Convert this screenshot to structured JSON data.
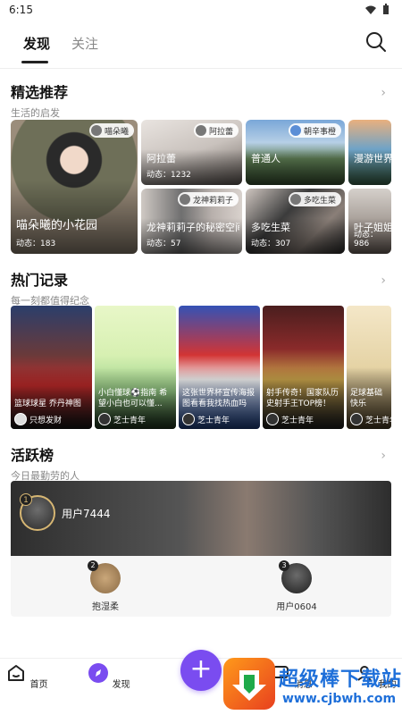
{
  "status": {
    "time": "6:15"
  },
  "nav": {
    "tab_active": "发现",
    "tab_inactive": "关注"
  },
  "featured": {
    "title": "精选推荐",
    "subtitle": "生活的启发",
    "cards": [
      {
        "label": "喵朵曦的小花园",
        "count": "动态：183",
        "user": "喵朵曦"
      },
      {
        "label": "阿拉蕾",
        "count": "动态：1232",
        "user": "阿拉蕾"
      },
      {
        "label": "普通人",
        "count": "",
        "user": "朝辛事橙"
      },
      {
        "label": "漫游世界",
        "count": "",
        "user": ""
      },
      {
        "label": "龙神莉莉子的秘密空间",
        "count": "动态：57",
        "user": "龙神莉莉子"
      },
      {
        "label": "多吃生菜",
        "count": "动态：307",
        "user": "多吃生菜"
      },
      {
        "label": "叶子姐姐",
        "count": "动态：986",
        "user": ""
      }
    ]
  },
  "hot": {
    "title": "热门记录",
    "subtitle": "每一刻都值得纪念",
    "items": [
      {
        "text": "篮球球星 乔丹神图",
        "author": "只想发财"
      },
      {
        "text": "小白懂球⚽指南 希望小白也可以懂...",
        "author": "芝士青年"
      },
      {
        "text": "这张世界杯宣传海报 图看看我找热血吗",
        "author": "芝士青年"
      },
      {
        "text": "射手传奇！国家队历史射手王TOP榜！",
        "author": "芝士青年"
      },
      {
        "text": "足球基础 快乐",
        "author": "芝士青年"
      }
    ]
  },
  "activity": {
    "title": "活跃榜",
    "subtitle": "今日最勤劳的人",
    "first": {
      "rank": "1",
      "name": "用户7444"
    },
    "others": [
      {
        "rank": "2",
        "name": "抱湿柔"
      },
      {
        "rank": "3",
        "name": "用户0604"
      }
    ]
  },
  "bottom_nav": {
    "home": "首页",
    "discover": "发现",
    "add": "+",
    "messages": "消息",
    "mine": "我的"
  },
  "watermark": {
    "text": "超级棒下载站",
    "url": "www.cjbwh.com"
  },
  "colors": {
    "accent": "#7a4cf0",
    "text": "#222222"
  }
}
